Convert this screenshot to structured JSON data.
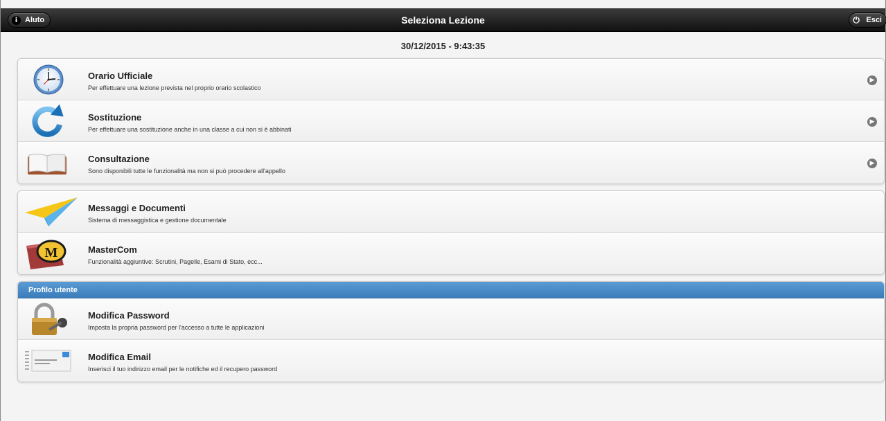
{
  "header": {
    "help_label": "Aluto",
    "title": "Seleziona Lezione",
    "exit_label": "Esci"
  },
  "datetime": "30/12/2015 - 9:43:35",
  "lessons": [
    {
      "title": "Orario Ufficiale",
      "desc": "Per effettuare una lezione prevista nel proprio orario scolastico",
      "icon": "clock-icon"
    },
    {
      "title": "Sostituzione",
      "desc": "Per effettuare una sostituzione anche in una classe a cui non si è abbinati",
      "icon": "refresh-arrow-icon"
    },
    {
      "title": "Consultazione",
      "desc": "Sono disponibili tutte le funzionalità ma non si può procedere all'appello",
      "icon": "open-book-icon"
    }
  ],
  "tools": [
    {
      "title": "Messaggi e Documenti",
      "desc": "Sistema di messaggistica e gestione documentale",
      "icon": "paper-plane-icon"
    },
    {
      "title": "MasterCom",
      "desc": "Funzionalità aggiuntive: Scrutini, Pagelle, Esami di Stato, ecc...",
      "icon": "mastercom-logo-icon"
    }
  ],
  "profile": {
    "heading": "Profilo utente",
    "items": [
      {
        "title": "Modifica Password",
        "desc": "Imposta la propria password per l'accesso a tutte le applicazioni",
        "icon": "padlock-key-icon"
      },
      {
        "title": "Modifica Email",
        "desc": "Inserisci il tuo indirizzo email per le notifiche ed il recupero password",
        "icon": "email-form-icon"
      }
    ]
  },
  "colors": {
    "topbar": "#1c1c1c",
    "section_header": "#4a8cc9",
    "chevron": "#777777"
  }
}
